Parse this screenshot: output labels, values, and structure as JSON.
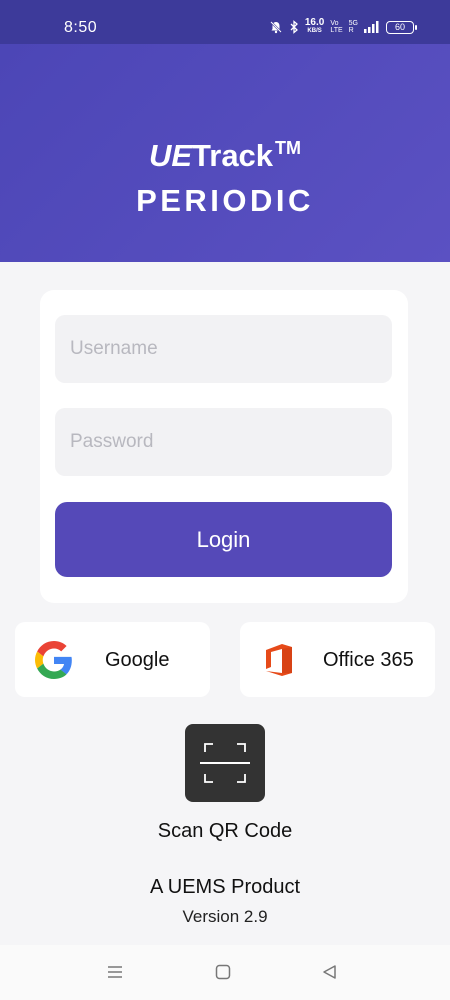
{
  "status_bar": {
    "time": "8:50",
    "network_speed": "16.0",
    "network_speed_unit": "KB/S",
    "volte_top": "Vo",
    "volte_bottom": "LTE",
    "signal_label_top": "5G",
    "signal_label_bottom": "R",
    "battery": "60",
    "icons": [
      "mute-bell-icon",
      "bluetooth-icon",
      "signal-icon",
      "battery-icon"
    ]
  },
  "header": {
    "brand_ue": "UE",
    "brand_track": "Track",
    "brand_tm": "TM",
    "subtitle": "PERIODIC",
    "background_color": "#4f48b9"
  },
  "login_form": {
    "username_placeholder": "Username",
    "username_value": "",
    "password_placeholder": "Password",
    "password_value": "",
    "login_label": "Login",
    "button_color": "#5549b8"
  },
  "sso": {
    "google_label": "Google",
    "office_label": "Office 365"
  },
  "qr": {
    "label": "Scan QR Code"
  },
  "footer": {
    "product": "A UEMS Product",
    "version": "Version 2.9"
  },
  "nav": {
    "icons": [
      "menu-icon",
      "home-icon",
      "back-icon"
    ]
  }
}
